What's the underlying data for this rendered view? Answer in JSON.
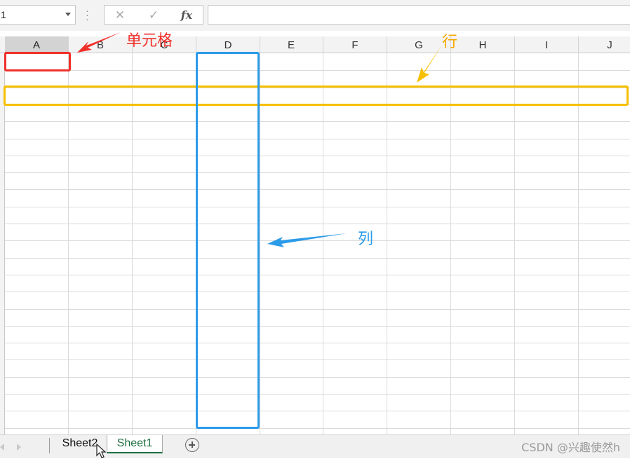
{
  "formula_bar": {
    "name_box_value": "1",
    "cancel_icon": "✕",
    "enter_icon": "✓",
    "fx_label": "fx",
    "formula_value": ""
  },
  "columns": [
    "A",
    "B",
    "C",
    "D",
    "E",
    "F",
    "G",
    "H",
    "I",
    "J"
  ],
  "selected_column": "A",
  "sheets": {
    "tabs": [
      "Sheet2",
      "Sheet1"
    ],
    "active": "Sheet1"
  },
  "annotations": {
    "cell": "单元格",
    "row": "行",
    "column": "列"
  },
  "colors": {
    "cell_annotation": "#f0302a",
    "row_annotation": "#f6bf00",
    "column_annotation": "#2c9be8",
    "active_sheet": "#1e6e42"
  },
  "watermark": "CSDN @兴趣使然h"
}
